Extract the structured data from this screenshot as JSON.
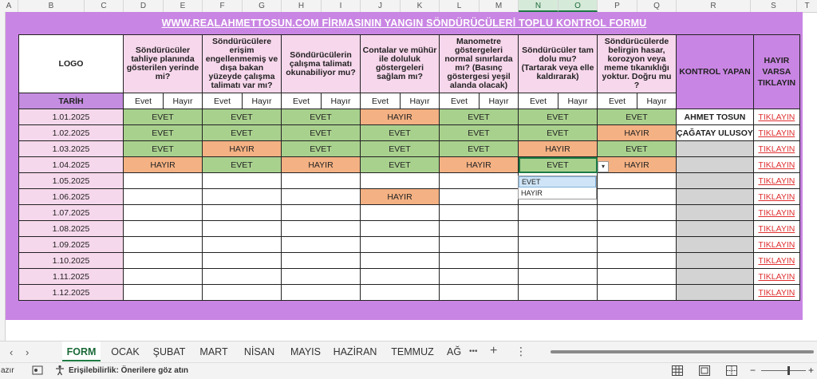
{
  "columns": [
    "A",
    "B",
    "C",
    "D",
    "E",
    "F",
    "G",
    "H",
    "I",
    "J",
    "K",
    "L",
    "M",
    "N",
    "O",
    "P",
    "Q",
    "R",
    "S",
    "T"
  ],
  "form": {
    "title": "WWW.REALAHMETTOSUN.COM FİRMASININ YANGIN SÖNDÜRÜCÜLERİ TOPLU KONTROL FORMU",
    "logo": "LOGO",
    "tarih": "TARİH",
    "questions": [
      "Söndürücüler tahliye planında gösterilen yerinde mi?",
      "Söndürücülere erişim engellenmemiş ve dışa bakan yüzeyde çalışma talimatı var mı?",
      "Söndürücülerin çalışma talimatı okunabiliyor mu?",
      "Contalar ve mühür ile doluluk göstergeleri sağlam mı?",
      "Manometre göstergeleri normal sınırlarda mı? (Basınç göstergesi yeşil alanda olacak)",
      "Söndürücüler tam dolu mu? (Tartarak veya elle kaldırarak)",
      "Söndürücülerde belirgin hasar, korozyon veya meme tıkanıklığı yoktur. Doğru mu ?"
    ],
    "evet": "Evet",
    "hayir": "Hayır",
    "kontrol_yapan": "KONTROL YAPAN",
    "hayir_varsa": "HAYIR VARSA TIKLAYIN",
    "rows": [
      {
        "date": "1.01.2025",
        "answers": [
          "EVET",
          "EVET",
          "EVET",
          "HAYIR",
          "EVET",
          "EVET",
          "EVET"
        ],
        "person": "AHMET TOSUN",
        "link": "TIKLAYIN"
      },
      {
        "date": "1.02.2025",
        "answers": [
          "EVET",
          "EVET",
          "EVET",
          "EVET",
          "EVET",
          "EVET",
          "HAYIR"
        ],
        "person": "ÇAĞATAY ULUSOY",
        "link": "TIKLAYIN"
      },
      {
        "date": "1.03.2025",
        "answers": [
          "EVET",
          "HAYIR",
          "EVET",
          "EVET",
          "EVET",
          "HAYIR",
          "EVET"
        ],
        "person": "",
        "link": "TIKLAYIN"
      },
      {
        "date": "1.04.2025",
        "answers": [
          "HAYIR",
          "EVET",
          "HAYIR",
          "EVET",
          "HAYIR",
          "EVET",
          "HAYIR"
        ],
        "person": "",
        "link": "TIKLAYIN"
      },
      {
        "date": "1.05.2025",
        "answers": [
          "",
          "",
          "",
          "",
          "",
          "",
          ""
        ],
        "person": "",
        "link": "TIKLAYIN"
      },
      {
        "date": "1.06.2025",
        "answers": [
          "",
          "",
          "",
          "HAYIR",
          "",
          "",
          ""
        ],
        "person": "",
        "link": "TIKLAYIN"
      },
      {
        "date": "1.07.2025",
        "answers": [
          "",
          "",
          "",
          "",
          "",
          "",
          ""
        ],
        "person": "",
        "link": "TIKLAYIN"
      },
      {
        "date": "1.08.2025",
        "answers": [
          "",
          "",
          "",
          "",
          "",
          "",
          ""
        ],
        "person": "",
        "link": "TIKLAYIN"
      },
      {
        "date": "1.09.2025",
        "answers": [
          "",
          "",
          "",
          "",
          "",
          "",
          ""
        ],
        "person": "",
        "link": "TIKLAYIN"
      },
      {
        "date": "1.10.2025",
        "answers": [
          "",
          "",
          "",
          "",
          "",
          "",
          ""
        ],
        "person": "",
        "link": "TIKLAYIN"
      },
      {
        "date": "1.11.2025",
        "answers": [
          "",
          "",
          "",
          "",
          "",
          "",
          ""
        ],
        "person": "",
        "link": "TIKLAYIN"
      },
      {
        "date": "1.12.2025",
        "answers": [
          "",
          "",
          "",
          "",
          "",
          "",
          ""
        ],
        "person": "",
        "link": "TIKLAYIN"
      }
    ]
  },
  "dropdown": {
    "arrow": "▾",
    "options": [
      "EVET",
      "HAYIR"
    ],
    "highlighted": "EVET"
  },
  "tabs": {
    "prev": "‹",
    "next": "›",
    "sheets": [
      "FORM",
      "OCAK",
      "ŞUBAT",
      "MART",
      "NİSAN",
      "MAYIS",
      "HAZİRAN",
      "TEMMUZ",
      "AĞ"
    ],
    "active": "FORM",
    "more": "•••",
    "add": "+",
    "menu": "⋮"
  },
  "status": {
    "ready": "azır",
    "accessibility": "Erişilebilirlik: Önerilere göz atın",
    "zoom_minus": "−",
    "zoom_plus": "+"
  },
  "colors": {
    "purple": "#c985e3",
    "evet": "#a9d18e",
    "hayir": "#f4b183",
    "date_pink": "#f6d8ec",
    "link_red": "#e03030"
  }
}
